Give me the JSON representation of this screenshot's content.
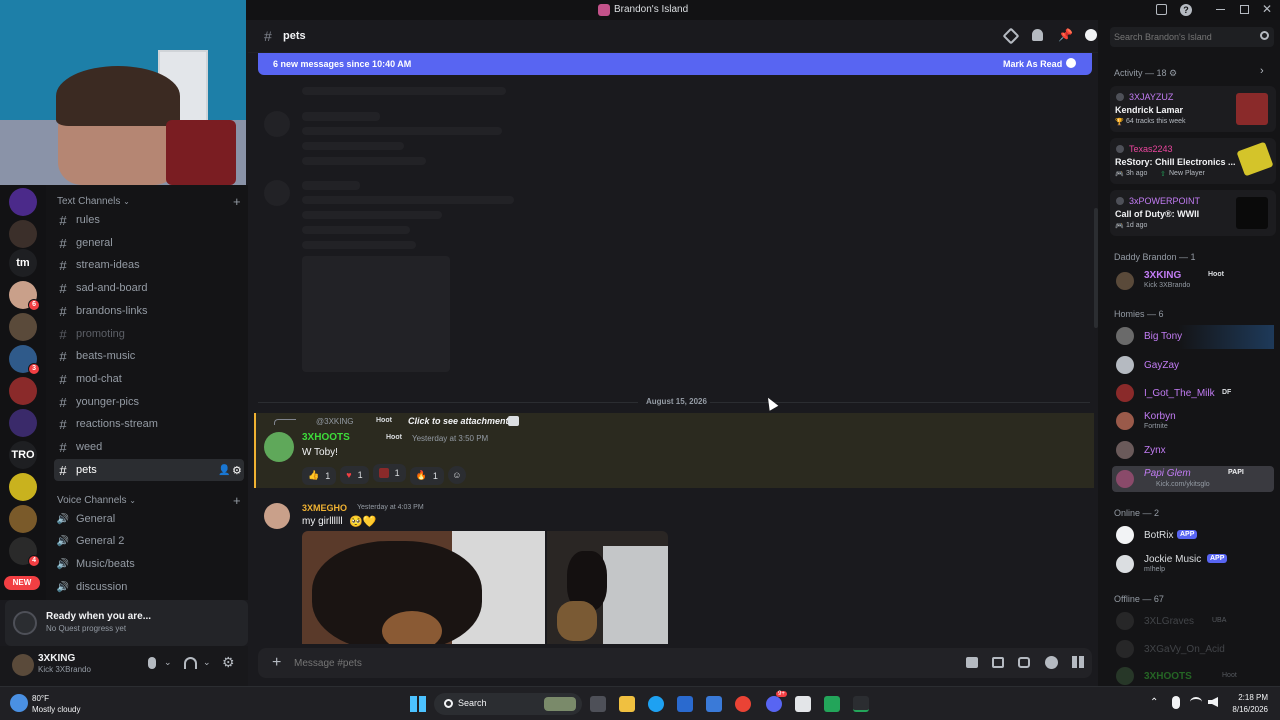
{
  "window": {
    "title": "Brandon's Island"
  },
  "channel_header": {
    "name": "pets"
  },
  "new_messages": {
    "text": "6 new messages since 10:40 AM",
    "mark_read": "Mark As Read"
  },
  "sidebar": {
    "text_category": "Text Channels",
    "text_channels": [
      "rules",
      "general",
      "stream-ideas",
      "sad-and-board",
      "brandons-links",
      "promoting",
      "beats-music",
      "mod-chat",
      "younger-pics",
      "reactions-stream",
      "weed",
      "pets"
    ],
    "voice_category": "Voice Channels",
    "voice_channels": [
      "General",
      "General 2",
      "Music/beats",
      "discussion"
    ]
  },
  "guilds": {
    "tm": "tm",
    "tro": "TRO",
    "new": "NEW",
    "badge_1": "6",
    "badge_2": "3",
    "badge_3": "4"
  },
  "quest": {
    "title": "Ready when you are...",
    "subtitle": "No Quest progress yet"
  },
  "user": {
    "name": "3XKING",
    "status": "Kick 3XBrando"
  },
  "messages": {
    "date_divider": "August 15, 2026",
    "reply": {
      "name": "@3XKING",
      "tag": "Hoot",
      "text": "Click to see attachment"
    },
    "m1": {
      "author": "3XHOOTS",
      "tag": "Hoot",
      "time": "Yesterday at 3:50 PM",
      "text": "W Toby!",
      "reactions": [
        "1",
        "1",
        "1",
        "1"
      ]
    },
    "m2": {
      "author": "3XMEGHO",
      "time": "Yesterday at 4:03 PM",
      "text": "my girllllll"
    }
  },
  "composer": {
    "placeholder": "Message #pets"
  },
  "search": {
    "placeholder": "Search Brandon's Island"
  },
  "activity": {
    "header": "Activity — 18",
    "items": [
      {
        "user": "3XJAYZUZ",
        "title": "Kendrick Lamar",
        "sub": "64 tracks this week"
      },
      {
        "user": "Texas2243",
        "title": "ReStory: Chill Electronics ...",
        "sub": "3h ago",
        "sub2": "New Player"
      },
      {
        "user": "3xPOWERPOINT",
        "title": "Call of Duty®: WWII",
        "sub": "1d ago"
      }
    ]
  },
  "members": {
    "daddy_header": "Daddy Brandon — 1",
    "daddy": {
      "name": "3XKING",
      "tag": "Hoot",
      "sub": "Kick 3XBrando"
    },
    "homies_header": "Homies — 6",
    "homies": [
      {
        "name": "Big Tony"
      },
      {
        "name": "GayZay"
      },
      {
        "name": "I_Got_The_Milk",
        "tag": "DF"
      },
      {
        "name": "Korbyn",
        "sub": "Fortnite"
      },
      {
        "name": "Zynx"
      },
      {
        "name": "Papi Glem",
        "tag": "PAPI",
        "sub": "Kick.com/ykitsglo"
      }
    ],
    "online_header": "Online — 2",
    "online": [
      {
        "name": "BotRix",
        "tag": "APP"
      },
      {
        "name": "Jockie Music",
        "tag": "APP",
        "sub": "m!help"
      }
    ],
    "offline_header": "Offline — 67",
    "offline": [
      {
        "name": "3XLGraves",
        "tag": "UBA"
      },
      {
        "name": "3XGaVy_On_Acid"
      },
      {
        "name": "3XHOOTS",
        "tag": "Hoot"
      }
    ]
  },
  "taskbar": {
    "weather_temp": "80°F",
    "weather_desc": "Mostly cloudy",
    "search": "Search",
    "time": "2:18 PM",
    "date": "8/16/2026",
    "discord_badge": "9+"
  }
}
